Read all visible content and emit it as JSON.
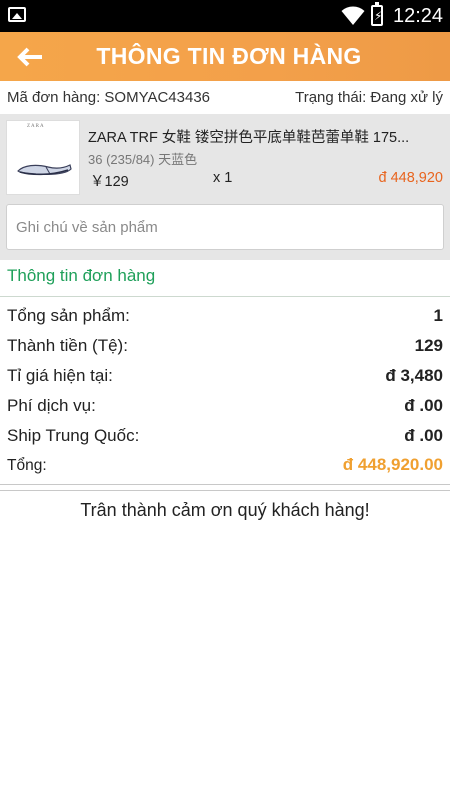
{
  "status_bar": {
    "time": "12:24",
    "icons": [
      "gallery-icon",
      "wifi-icon",
      "battery-charging-icon"
    ]
  },
  "header": {
    "title": "THÔNG TIN ĐƠN HÀNG",
    "back_icon": "arrow-left-icon"
  },
  "order": {
    "code_text": "Mã đơn hàng: SOMYAC43436",
    "status_text": "Trạng thái: Đang xử lý"
  },
  "product": {
    "thumb_brand": "ZARA",
    "name": "ZARA TRF 女鞋 镂空拼色平底单鞋芭蕾单鞋 175...",
    "variant": "36 (235/84) 天蓝色",
    "unit_price": "￥129",
    "quantity": "x 1",
    "line_total": "đ 448,920",
    "note_placeholder": "Ghi chú về sản phẩm",
    "note_value": ""
  },
  "summary": {
    "section_title": "Thông tin đơn hàng",
    "rows": [
      {
        "label": "Tổng sản phẩm:",
        "value": "1"
      },
      {
        "label": "Thành tiền (Tệ):",
        "value": "129"
      },
      {
        "label": "Tỉ giá hiện tại:",
        "value": "đ 3,480"
      },
      {
        "label": "Phí dịch vụ:",
        "value": "đ .00"
      },
      {
        "label": "Ship Trung Quốc:",
        "value": "đ .00"
      }
    ],
    "total_label": "Tổng:",
    "total_value": "đ 448,920.00"
  },
  "footer": {
    "thanks": "Trân thành cảm ơn quý khách hàng!"
  },
  "colors": {
    "header_orange": "#f3a04a",
    "accent_green": "#1fa05a",
    "price_orange": "#e8641e",
    "total_orange": "#f0a030"
  }
}
